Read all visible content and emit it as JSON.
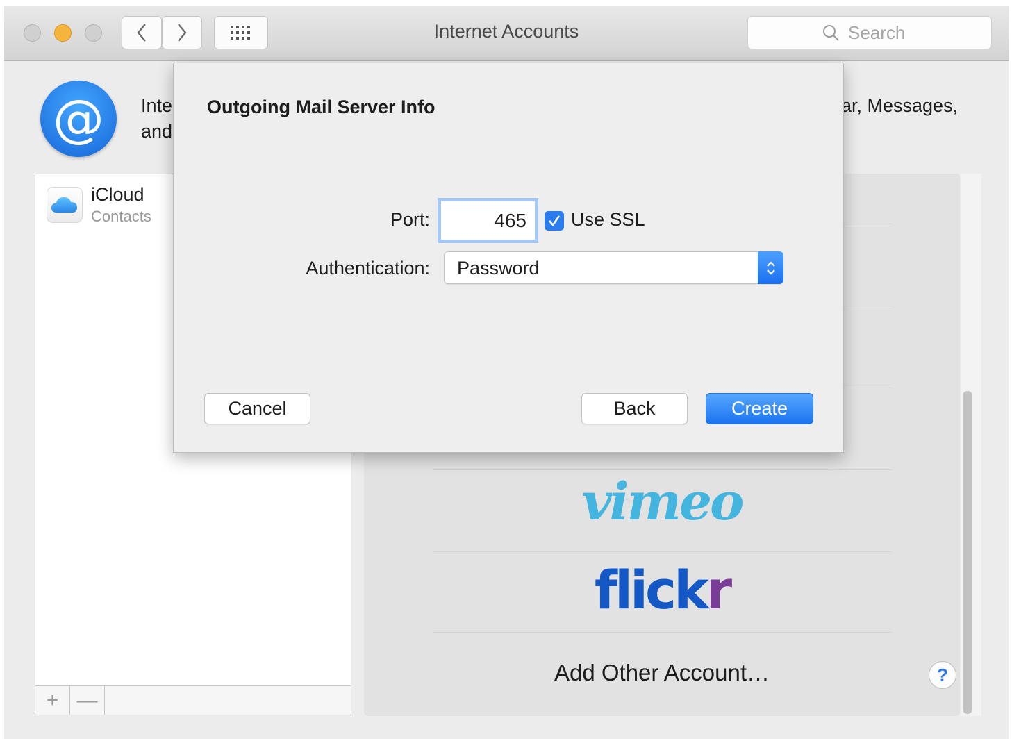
{
  "window": {
    "title": "Internet Accounts",
    "search_placeholder": "Search"
  },
  "toolbar": {
    "icons": [
      "close-button-inactive",
      "minimize-button",
      "zoom-button-inactive",
      "chevron-left-icon",
      "chevron-right-icon",
      "grid-icon",
      "search-icon"
    ]
  },
  "header": {
    "icon": "at-sign-icon",
    "icon_glyph": "@",
    "description_left": "Inte\nand",
    "description_right": "ar, Messages,"
  },
  "accounts": {
    "items": [
      {
        "name": "iCloud",
        "subtitle": "Contacts",
        "icon": "icloud-icon"
      }
    ],
    "add_glyph": "+",
    "remove_glyph": "—"
  },
  "providers": {
    "vimeo": "vimeo",
    "flickr_part1": "flick",
    "flickr_part2": "r",
    "add_other": "Add Other Account…",
    "help_glyph": "?"
  },
  "sheet": {
    "title": "Outgoing Mail Server Info",
    "port_label": "Port:",
    "port_value": "465",
    "use_ssl_label": "Use SSL",
    "use_ssl_checked": true,
    "auth_label": "Authentication:",
    "auth_value": "Password",
    "cancel_label": "Cancel",
    "back_label": "Back",
    "create_label": "Create"
  },
  "colors": {
    "accent": "#1c74f0",
    "vimeo": "#44b5df",
    "flickr_blue": "#1358c4",
    "flickr_purple": "#7a3d97",
    "minimize": "#f6b43c"
  }
}
